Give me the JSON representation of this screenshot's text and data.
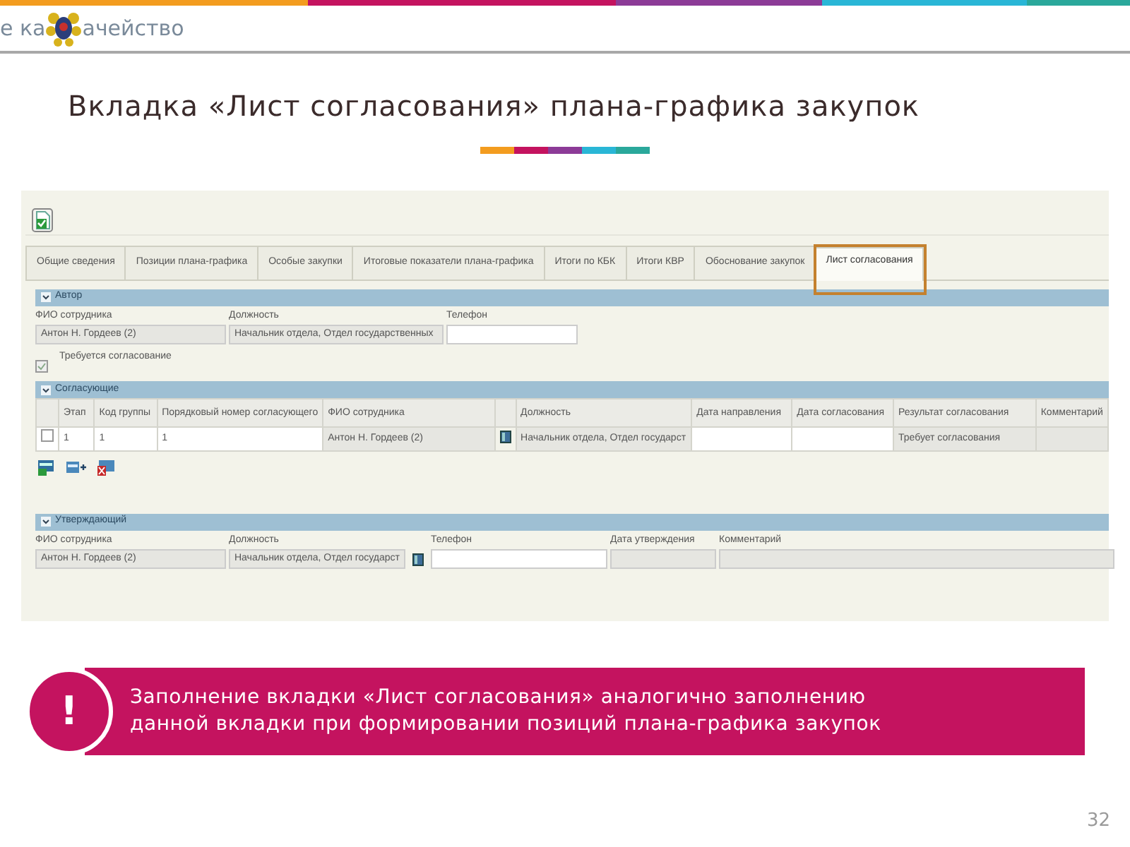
{
  "header": {
    "logo_text_left": "е ка",
    "logo_text_right": "ачейство"
  },
  "slide_title": "Вкладка «Лист согласования» плана-графика закупок",
  "app": {
    "tabs": [
      {
        "label": "Общие сведения",
        "selected": false
      },
      {
        "label": "Позиции плана-графика",
        "selected": false
      },
      {
        "label": "Особые закупки",
        "selected": false
      },
      {
        "label": "Итоговые показатели плана-графика",
        "selected": false
      },
      {
        "label": "Итоги по КБК",
        "selected": false
      },
      {
        "label": "Итоги КВР",
        "selected": false
      },
      {
        "label": "Обоснование закупок",
        "selected": false
      },
      {
        "label": "Лист согласования",
        "selected": true
      }
    ],
    "author": {
      "title": "Автор",
      "expanded": true,
      "fields": [
        {
          "label": "ФИО сотрудника",
          "value": "Антон Н. Гордеев (2)",
          "kind": "readonly"
        },
        {
          "label": "Должность",
          "value": "Начальник отдела, Отдел государственных",
          "kind": "readonly"
        },
        {
          "label": "Телефон",
          "kind": "input"
        }
      ]
    },
    "approval_required": {
      "label": "Требуется согласование",
      "checked": true
    },
    "approvers": {
      "title": "Согласующие",
      "expanded": true,
      "columns": [
        {
          "kind": "check"
        },
        {
          "label": "Этап",
          "kind": "text"
        },
        {
          "label": "Код группы",
          "kind": "text"
        },
        {
          "label": "Порядковый номер согласующего",
          "kind": "text"
        },
        {
          "label": "ФИО сотрудника",
          "kind": "text"
        },
        {
          "kind": "lookup"
        },
        {
          "label": "Должность",
          "kind": "text"
        },
        {
          "label": "Дата направления",
          "kind": "text"
        },
        {
          "label": "Дата согласования",
          "kind": "text"
        },
        {
          "label": "Результат согласования",
          "kind": "text"
        },
        {
          "label": "Комментарий",
          "kind": "text"
        }
      ],
      "rows": [
        {
          "checked": false,
          "cells": [
            {},
            {
              "value": "1",
              "kind": "input"
            },
            {
              "value": "1",
              "kind": "input"
            },
            {
              "value": "1",
              "kind": "input"
            },
            {
              "value": "Антон Н. Гордеев (2)",
              "kind": "readonly"
            },
            {},
            {
              "value": "Начальник отдела, Отдел государст",
              "kind": "readonly"
            },
            {
              "kind": "input"
            },
            {
              "kind": "input"
            },
            {
              "value": "Требует согласования",
              "kind": "readonly"
            },
            {
              "kind": "readonly"
            }
          ]
        }
      ]
    },
    "approver": {
      "title": "Утверждающий",
      "expanded": true,
      "fields": [
        {
          "label": "ФИО сотрудника",
          "value": "Антон Н. Гордеев (2)",
          "kind": "readonly"
        },
        {
          "label": "Должность",
          "value": "Начальник отдела, Отдел государст",
          "kind": "readonly",
          "lookup": true
        },
        {
          "label": "Телефон",
          "kind": "input"
        },
        {
          "label": "Дата утверждения",
          "kind": "readonly"
        },
        {
          "label": "Комментарий",
          "kind": "readonly"
        }
      ]
    }
  },
  "callout": {
    "mark": "!",
    "text": "Заполнение вкладки «Лист согласования» аналогично заполнению данной вкладки при формировании позиций плана-графика закупок"
  },
  "page_number": "32"
}
